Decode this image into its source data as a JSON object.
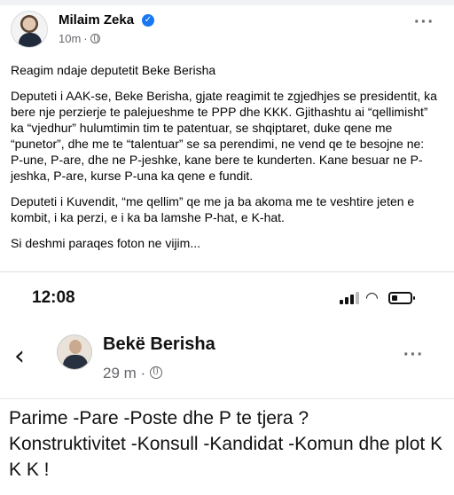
{
  "post": {
    "author": "Milaim Zeka",
    "time": "10m",
    "paragraphs": [
      "Reagim ndaje deputetit Beke Berisha",
      "Deputeti i AAK-se, Beke Berisha, gjate reagimit te zgjedhjes se presidentit, ka bere nje perzierje te palejueshme te PPP dhe KKK. Gjithashtu ai “qellimisht” ka “vjedhur” hulumtimin tim te patentuar, se shqiptaret, duke qene me “punetor”, dhe me te “talentuar” se sa perendimi, ne vend qe te besojne ne: P-une, P-are, dhe ne P-jeshke, kane bere te kunderten. Kane besuar ne P-jeshka, P-are, kurse P-una ka qene e fundit.",
      "Deputeti i Kuvendit, “me qellim” qe me ja ba akoma me te veshtire jeten e kombit, i ka perzi, e i ka ba lamshe P-hat, e K-hat.",
      "Si deshmi paraqes foton ne vijim..."
    ],
    "icons": {
      "verified": "verified-badge-icon",
      "audience": "globe-icon",
      "more": "more-options-icon"
    },
    "accent_color": "#1877f2"
  },
  "screenshot": {
    "clock": "12:08",
    "status_icons": [
      "cellular-signal-icon",
      "wifi-icon",
      "battery-icon"
    ],
    "battery_level": 0.3,
    "author": "Bekë Berisha",
    "time": "29 m",
    "text": "Parime -Pare -Poste dhe P te tjera ?\nKonstruktivitet -Konsull -Kandidat -Komun dhe  plot K K K !"
  }
}
